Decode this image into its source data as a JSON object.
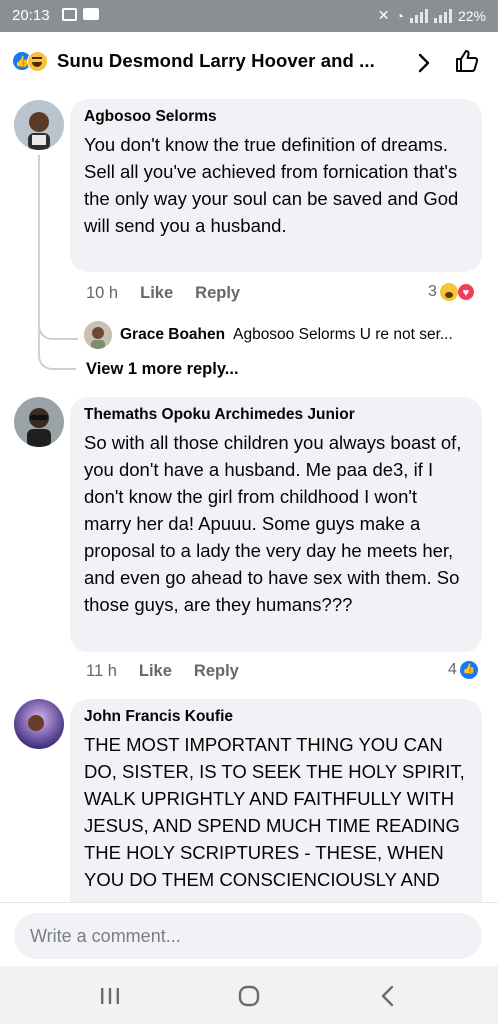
{
  "status_bar": {
    "time": "20:13",
    "battery": "22%"
  },
  "header": {
    "title": "Sunu Desmond Larry Hoover and ..."
  },
  "comments": [
    {
      "author": "Agbosoo Selorms",
      "text": "You don't know the true definition of dreams. Sell all you've achieved from fornication that's the only way your soul can be saved and God will send you a husband.",
      "time": "10 h",
      "like_label": "Like",
      "reply_label": "Reply",
      "reaction_count": "3",
      "reactions": [
        "haha",
        "love"
      ],
      "reply_preview": {
        "author": "Grace Boahen",
        "text": "Agbosoo Selorms U re not ser..."
      },
      "view_more": "View 1 more reply..."
    },
    {
      "author": "Themaths Opoku Archimedes Junior",
      "text": "So with all those children you always boast of, you don't have a husband. Me paa de3, if I don't know the girl from childhood I won't marry her da! Apuuu. Some guys make a proposal to a lady the very day he meets her, and even go ahead to have sex with them. So those guys, are they humans???",
      "time": "11 h",
      "like_label": "Like",
      "reply_label": "Reply",
      "reaction_count": "4",
      "reactions": [
        "like"
      ]
    },
    {
      "author": "John Francis Koufie",
      "text": "THE MOST IMPORTANT THING YOU CAN DO, SISTER, IS TO SEEK THE HOLY SPIRIT, WALK UPRIGHTLY AND FAITHFULLY WITH JESUS, AND SPEND MUCH TIME READING THE HOLY SCRIPTURES - THESE, WHEN YOU DO THEM CONSCIENCIOUSLY AND"
    }
  ],
  "composer": {
    "placeholder": "Write a comment..."
  },
  "colors": {
    "accent": "#1877f2",
    "bubble": "#f0f2f5",
    "muted": "#65676b",
    "status_bar": "#8a8f94",
    "nav_bar": "#f2f2f2"
  },
  "icons": [
    "like-reaction-icon",
    "haha-reaction-icon",
    "love-reaction-icon",
    "chevron-right-icon",
    "thumbs-up-icon",
    "recent-apps-icon",
    "home-icon",
    "back-icon"
  ]
}
